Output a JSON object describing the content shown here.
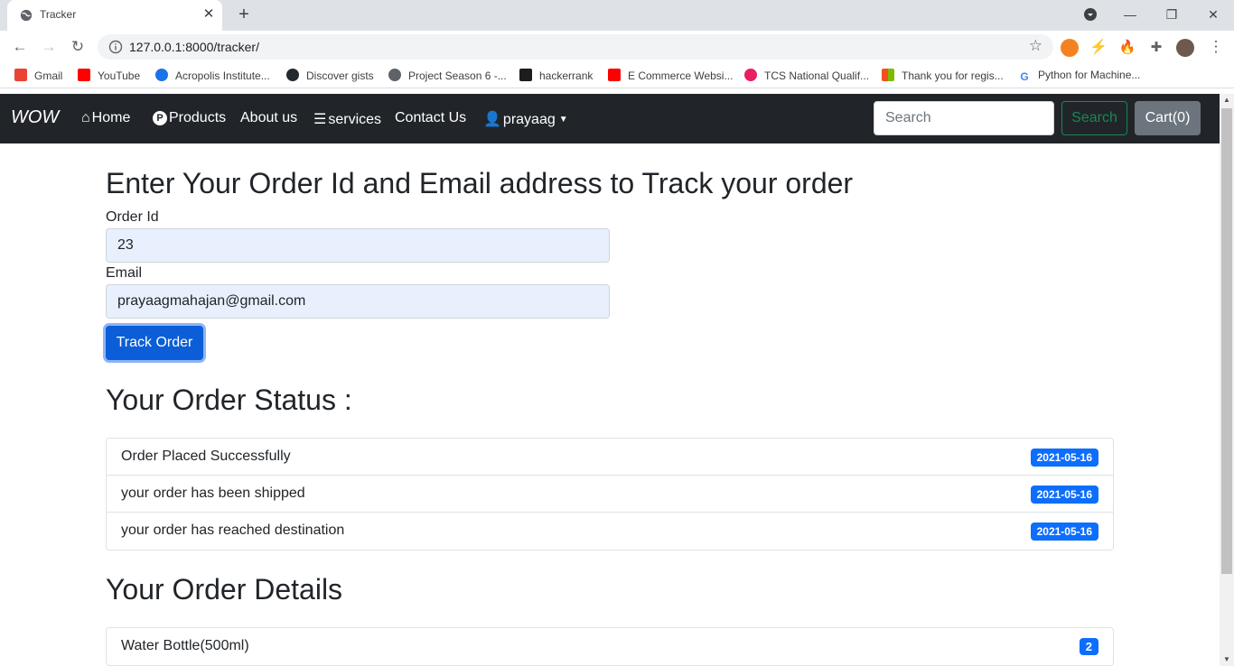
{
  "browser": {
    "tab_title": "Tracker",
    "url": "127.0.0.1:8000/tracker/",
    "bookmarks": [
      {
        "label": "Gmail",
        "icon": "gmail-icon",
        "color": "#ea4335"
      },
      {
        "label": "YouTube",
        "icon": "youtube-icon",
        "color": "#ff0000"
      },
      {
        "label": "Acropolis Institute...",
        "icon": "acropolis-icon",
        "color": "#1a73e8"
      },
      {
        "label": "Discover gists",
        "icon": "github-icon",
        "color": "#24292e"
      },
      {
        "label": "Project Season 6 -...",
        "icon": "globe-icon",
        "color": "#5f6368"
      },
      {
        "label": "hackerrank",
        "icon": "hackerrank-icon",
        "color": "#1ba94c"
      },
      {
        "label": "E Commerce Websi...",
        "icon": "youtube-icon",
        "color": "#ff0000"
      },
      {
        "label": "TCS National Qualif...",
        "icon": "tcs-icon",
        "color": "#e91e63"
      },
      {
        "label": "Thank you for regis...",
        "icon": "microsoft-icon",
        "color": "#f25022"
      },
      {
        "label": "Python for Machine...",
        "icon": "google-icon",
        "color": "#4285f4"
      }
    ]
  },
  "navbar": {
    "brand": "WOW",
    "links": [
      {
        "label": "Home",
        "icon": "home-icon"
      },
      {
        "label": "Products",
        "icon": "products-icon"
      },
      {
        "label": "About us",
        "icon": ""
      },
      {
        "label": "services",
        "icon": "services-icon"
      },
      {
        "label": "Contact Us",
        "icon": ""
      },
      {
        "label": "prayaag",
        "icon": "user-icon"
      }
    ],
    "search_placeholder": "Search",
    "search_button": "Search",
    "cart_button": "Cart(0)"
  },
  "form": {
    "heading": "Enter Your Order Id and Email address to Track your order",
    "order_id_label": "Order Id",
    "order_id_value": "23",
    "email_label": "Email",
    "email_value": "prayaagmahajan@gmail.com",
    "submit_label": "Track Order"
  },
  "status": {
    "heading": "Your Order Status :",
    "items": [
      {
        "text": "Order Placed Successfully",
        "date": "2021-05-16"
      },
      {
        "text": "your order has been shipped",
        "date": "2021-05-16"
      },
      {
        "text": "your order has reached destination",
        "date": "2021-05-16"
      }
    ]
  },
  "details": {
    "heading": "Your Order Details",
    "items": [
      {
        "text": "Water Bottle(500ml)",
        "qty": "2"
      }
    ]
  },
  "colors": {
    "navbar_bg": "#212529",
    "primary": "#0d6efd",
    "success": "#198754",
    "secondary": "#6c757d"
  }
}
